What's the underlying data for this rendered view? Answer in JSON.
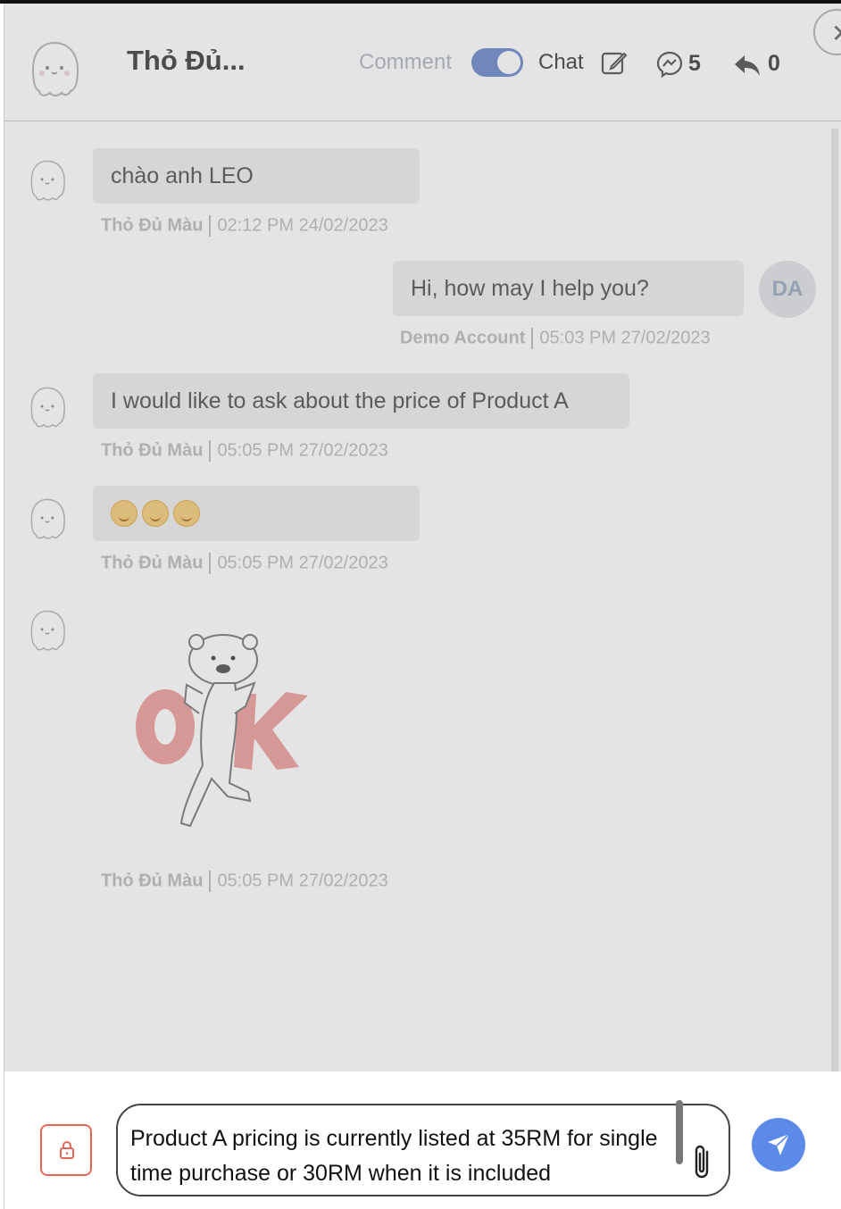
{
  "header": {
    "contact_name": "Thỏ Đủ...",
    "tab_comment": "Comment",
    "tab_chat": "Chat",
    "chat_enabled": true,
    "message_count": "5",
    "reply_count": "0",
    "icons": [
      "edit-icon",
      "messenger-icon",
      "reply-icon",
      "close-icon"
    ]
  },
  "messages": [
    {
      "sender": "Thỏ Đủ Màu",
      "side": "left",
      "text": "chào anh LEO",
      "time": "02:12 PM 24/02/2023"
    },
    {
      "sender": "Demo Account",
      "side": "right",
      "avatar_initials": "DA",
      "text": "Hi, how may I help you?",
      "time": "05:03 PM 27/02/2023"
    },
    {
      "sender": "Thỏ Đủ Màu",
      "side": "left",
      "text": "I would like to ask about the price of Product A",
      "time": "05:05 PM 27/02/2023"
    },
    {
      "sender": "Thỏ Đủ Màu",
      "side": "left",
      "emoji": "smiling-face-with-hearts",
      "emoji_count": 3,
      "time": "05:05 PM 27/02/2023"
    },
    {
      "sender": "Thỏ Đủ Màu",
      "side": "left",
      "sticker": "bear-ok-sticker",
      "time": "05:05 PM 27/02/2023"
    }
  ],
  "composer": {
    "value": "Product A pricing is currently listed at 35RM for single time purchase or 30RM when it is included",
    "icons": [
      "lock-icon",
      "paperclip-icon",
      "send-icon"
    ]
  },
  "colors": {
    "accent": "#5b8ae8",
    "lock_border": "#e2695a",
    "toggle": "#7e98d2"
  }
}
